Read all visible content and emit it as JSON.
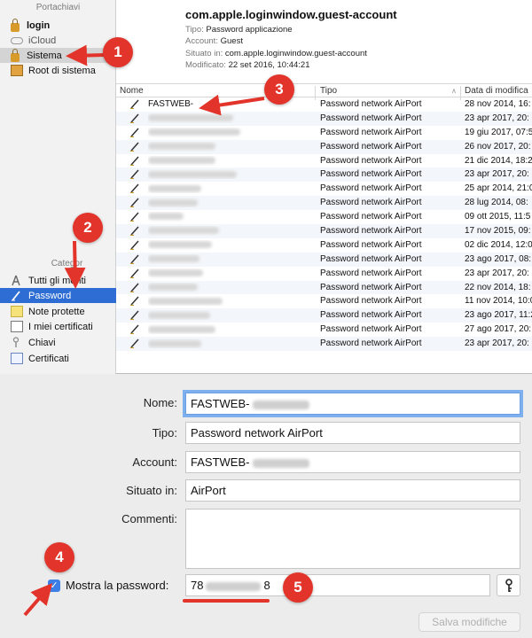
{
  "sidebar": {
    "keychains_header": "Portachiavi",
    "keychains": [
      {
        "label": "login",
        "icon": "lock-icon"
      },
      {
        "label": "iCloud",
        "icon": "cloud-icon"
      },
      {
        "label": "Sistema",
        "icon": "lock-icon"
      },
      {
        "label": "Root di sistema",
        "icon": "cabinet-icon"
      }
    ],
    "categories_header": "Categor",
    "categories": [
      {
        "label": "Tutti gli  menti",
        "icon": "all-items-icon"
      },
      {
        "label": "Password",
        "icon": "password-pen-icon"
      },
      {
        "label": "Note protette",
        "icon": "note-icon"
      },
      {
        "label": "I miei certificati",
        "icon": "certificate-icon"
      },
      {
        "label": "Chiavi",
        "icon": "key-icon"
      },
      {
        "label": "Certificati",
        "icon": "certificate-icon"
      }
    ]
  },
  "item_header": {
    "title": "com.apple.loginwindow.guest-account",
    "tipo_label": "Tipo:",
    "tipo_value": "Password applicazione",
    "account_label": "Account:",
    "account_value": "Guest",
    "situato_label": "Situato in:",
    "situato_value": "com.apple.loginwindow.guest-account",
    "modificato_label": "Modificato:",
    "modificato_value": "22 set 2016, 10:44:21"
  },
  "table": {
    "columns": [
      "Nome",
      "Tipo",
      "Data di modifica"
    ],
    "rows": [
      {
        "name": "FASTWEB-",
        "type": "Password network AirPort",
        "date": "28 nov 2014, 16:"
      },
      {
        "name": "",
        "type": "Password network AirPort",
        "date": "23 apr 2017, 20:"
      },
      {
        "name": "",
        "type": "Password network AirPort",
        "date": "19 giu 2017, 07:5"
      },
      {
        "name": "",
        "type": "Password network AirPort",
        "date": "26 nov 2017, 20:"
      },
      {
        "name": "",
        "type": "Password network AirPort",
        "date": "21 dic 2014, 18:2"
      },
      {
        "name": "",
        "type": "Password network AirPort",
        "date": "23 apr 2017, 20:"
      },
      {
        "name": "",
        "type": "Password network AirPort",
        "date": "25 apr 2014, 21:0"
      },
      {
        "name": "",
        "type": "Password network AirPort",
        "date": "28 lug 2014, 08:"
      },
      {
        "name": "",
        "type": "Password network AirPort",
        "date": "09 ott 2015, 11:5"
      },
      {
        "name": "",
        "type": "Password network AirPort",
        "date": "17 nov 2015, 09:"
      },
      {
        "name": "",
        "type": "Password network AirPort",
        "date": "02 dic 2014, 12:0"
      },
      {
        "name": "",
        "type": "Password network AirPort",
        "date": "23 ago 2017, 08:"
      },
      {
        "name": "",
        "type": "Password network AirPort",
        "date": "23 apr 2017, 20:"
      },
      {
        "name": "",
        "type": "Password network AirPort",
        "date": "22 nov 2014, 18:"
      },
      {
        "name": "",
        "type": "Password network AirPort",
        "date": "11 nov 2014, 10:0"
      },
      {
        "name": "",
        "type": "Password network AirPort",
        "date": "23 ago 2017, 11:2"
      },
      {
        "name": "",
        "type": "Password network AirPort",
        "date": "27 ago 2017, 20:"
      },
      {
        "name": "",
        "type": "Password network AirPort",
        "date": "23 apr 2017, 20:"
      }
    ]
  },
  "form": {
    "nome_label": "Nome:",
    "nome_value": "FASTWEB-",
    "tipo_label": "Tipo:",
    "tipo_value": "Password network AirPort",
    "account_label": "Account:",
    "account_value": "FASTWEB-",
    "situato_label": "Situato in:",
    "situato_value": "AirPort",
    "commenti_label": "Commenti:",
    "commenti_value": "",
    "show_password_label": "Mostra la password:",
    "show_password_checked": true,
    "password_start": "78",
    "password_end": "8",
    "save_label": "Salva modifiche"
  },
  "annotations": [
    "1",
    "2",
    "3",
    "4",
    "5"
  ],
  "colors": {
    "selection": "#2d6dd4",
    "annotation": "#e2342a",
    "focus_ring": "#7fb0ee"
  }
}
